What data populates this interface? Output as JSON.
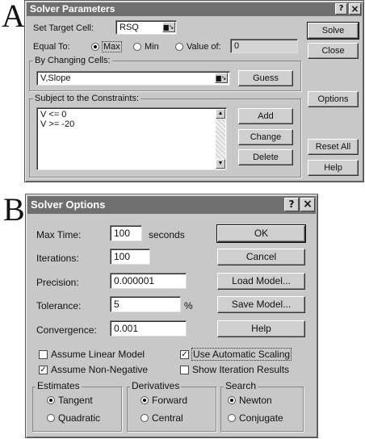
{
  "panel_labels": {
    "a": "A",
    "b": "B"
  },
  "solver_parameters": {
    "title": "Solver Parameters",
    "title_buttons": {
      "help": "?",
      "close": "×"
    },
    "set_target_cell_label": "Set Target Cell:",
    "target_cell_value": "RSQ",
    "equal_to_label": "Equal To:",
    "equal_to_options": [
      {
        "label": "Max",
        "selected": true
      },
      {
        "label": "Min",
        "selected": false
      },
      {
        "label": "Value of:",
        "selected": false
      }
    ],
    "value_of_value": "0",
    "by_changing_cells_label": "By Changing Cells:",
    "changing_cells_value": "V,Slope",
    "guess_label": "Guess",
    "constraints_label": "Subject to the Constraints:",
    "constraints": [
      "V <= 0",
      "V >= -20"
    ],
    "add_label": "Add",
    "change_label": "Change",
    "delete_label": "Delete",
    "solve_label": "Solve",
    "close_label": "Close",
    "options_label": "Options",
    "reset_all_label": "Reset All",
    "help_label": "Help"
  },
  "solver_options": {
    "title": "Solver Options",
    "title_buttons": {
      "help": "?",
      "close": "×"
    },
    "max_time_label": "Max Time:",
    "max_time_value": "100",
    "max_time_unit": "seconds",
    "iterations_label": "Iterations:",
    "iterations_value": "100",
    "precision_label": "Precision:",
    "precision_value": "0.000001",
    "tolerance_label": "Tolerance:",
    "tolerance_value": "5",
    "tolerance_unit": "%",
    "convergence_label": "Convergence:",
    "convergence_value": "0.001",
    "ok_label": "OK",
    "cancel_label": "Cancel",
    "load_model_label": "Load Model...",
    "save_model_label": "Save Model...",
    "help_label": "Help",
    "checkboxes": [
      {
        "label": "Assume Linear Model",
        "checked": false
      },
      {
        "label": "Use Automatic Scaling",
        "checked": true
      },
      {
        "label": "Assume Non-Negative",
        "checked": true
      },
      {
        "label": "Show Iteration Results",
        "checked": false
      }
    ],
    "estimates": {
      "label": "Estimates",
      "options": [
        {
          "label": "Tangent",
          "selected": true
        },
        {
          "label": "Quadratic",
          "selected": false
        }
      ]
    },
    "derivatives": {
      "label": "Derivatives",
      "options": [
        {
          "label": "Forward",
          "selected": true
        },
        {
          "label": "Central",
          "selected": false
        }
      ]
    },
    "search": {
      "label": "Search",
      "options": [
        {
          "label": "Newton",
          "selected": true
        },
        {
          "label": "Conjugate",
          "selected": false
        }
      ]
    }
  }
}
